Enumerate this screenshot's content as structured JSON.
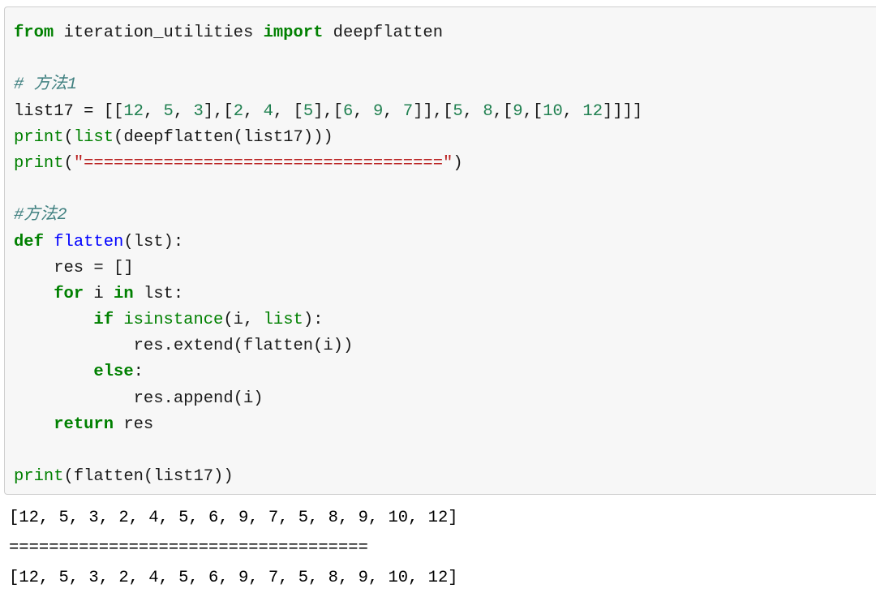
{
  "theme": {
    "cell_background": "#f7f7f7",
    "cell_border": "#cfcfcf",
    "page_background": "#ffffff",
    "keyword_color": "#008000",
    "builtin_color": "#008000",
    "function_name_color": "#0000ff",
    "number_color": "#208050",
    "string_color": "#ba2121",
    "comment_color": "#408080",
    "text_color": "#1a1a1a",
    "output_color": "#000000"
  },
  "cell": {
    "language": "python",
    "lines": {
      "l1_kw_from": "from",
      "l1_module": " iteration_utilities ",
      "l1_kw_import": "import",
      "l1_name": " deepflatten",
      "l3_comment": "# 方法1",
      "l4_var": "list17 = [[",
      "l4_n12": "12",
      "l4_sep1": ", ",
      "l4_n5": "5",
      "l4_sep2": ", ",
      "l4_n3": "3",
      "l4_sep3": "],[",
      "l4_n2": "2",
      "l4_sep4": ", ",
      "l4_n4": "4",
      "l4_sep5": ", [",
      "l4_n5b": "5",
      "l4_sep6": "],[",
      "l4_n6": "6",
      "l4_sep7": ", ",
      "l4_n9": "9",
      "l4_sep8": ", ",
      "l4_n7": "7",
      "l4_sep9": "]],[",
      "l4_n5c": "5",
      "l4_sep10": ", ",
      "l4_n8": "8",
      "l4_sep11": ",[",
      "l4_n9b": "9",
      "l4_sep12": ",[",
      "l4_n10": "10",
      "l4_sep13": ", ",
      "l4_n12b": "12",
      "l4_sep14": "]]]]",
      "l5_print": "print",
      "l5_open": "(",
      "l5_list": "list",
      "l5_rest": "(deepflatten(list17)))",
      "l6_print": "print",
      "l6_open": "(",
      "l6_string": "\"====================================\"",
      "l6_close": ")",
      "l8_comment": "#方法2",
      "l9_kw_def": "def",
      "l9_space": " ",
      "l9_fname": "flatten",
      "l9_args": "(lst):",
      "l10_text": "    res = []",
      "l11_indent": "    ",
      "l11_kw_for": "for",
      "l11_mid": " i ",
      "l11_kw_in": "in",
      "l11_end": " lst:",
      "l12_indent": "        ",
      "l12_kw_if": "if",
      "l12_space": " ",
      "l12_isinstance": "isinstance",
      "l12_open": "(i, ",
      "l12_list": "list",
      "l12_close": "):",
      "l13_text": "            res.extend(flatten(i))",
      "l14_indent": "        ",
      "l14_kw_else": "else",
      "l14_colon": ":",
      "l15_text": "            res.append(i)",
      "l16_indent": "    ",
      "l16_kw_return": "return",
      "l16_text": " res",
      "l18_print": "print",
      "l18_rest": "(flatten(list17))"
    }
  },
  "output": {
    "lines": [
      "[12, 5, 3, 2, 4, 5, 6, 9, 7, 5, 8, 9, 10, 12]",
      "====================================",
      "[12, 5, 3, 2, 4, 5, 6, 9, 7, 5, 8, 9, 10, 12]"
    ]
  },
  "flattened_result": [
    12,
    5,
    3,
    2,
    4,
    5,
    6,
    9,
    7,
    5,
    8,
    9,
    10,
    12
  ]
}
